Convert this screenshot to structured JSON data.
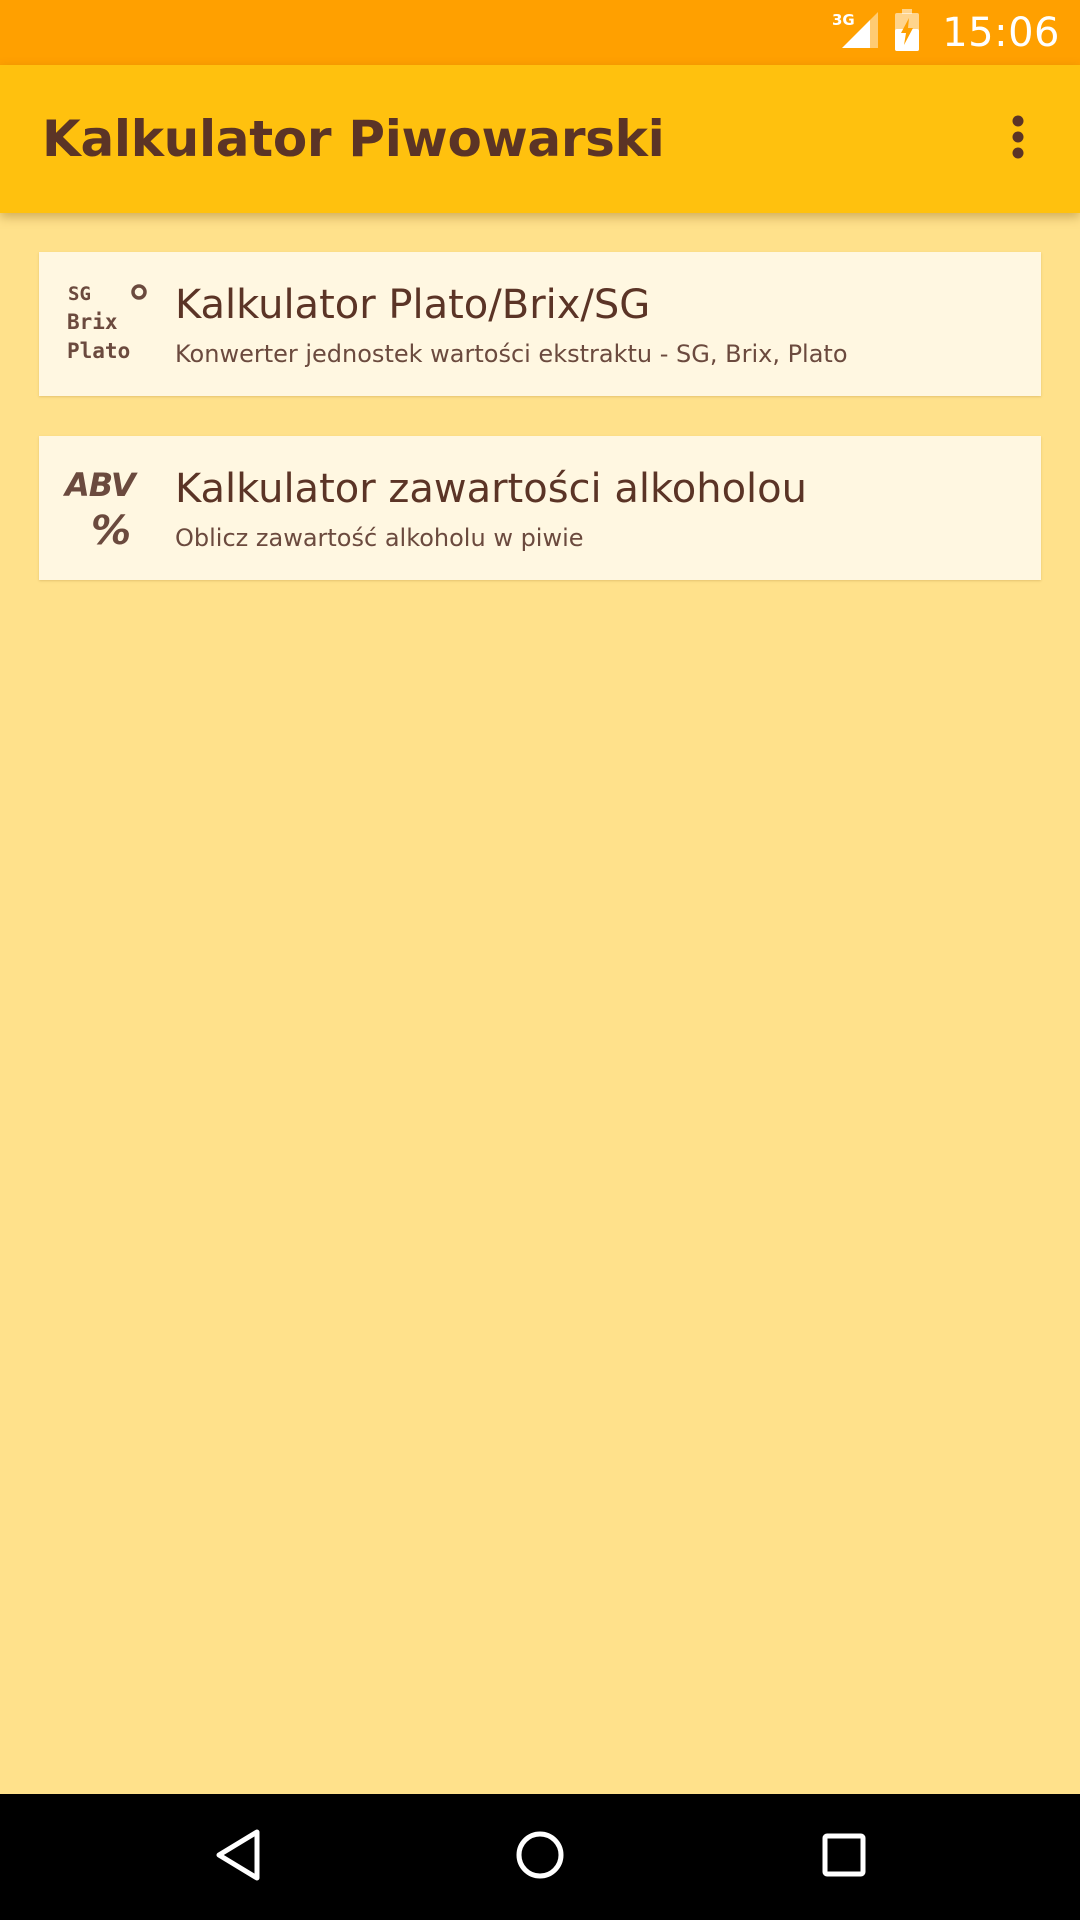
{
  "status_bar": {
    "network": "3G",
    "time": "15:06",
    "icons": [
      "signal-icon",
      "battery-charging-icon"
    ]
  },
  "app_bar": {
    "title": "Kalkulator Piwowarski",
    "overflow_icon": "more-vert-icon"
  },
  "menu": {
    "items": [
      {
        "icon": "plato-brix-sg-icon",
        "icon_text": [
          "SG",
          "Brix",
          "Plato",
          "°"
        ],
        "title": "Kalkulator Plato/Brix/SG",
        "subtitle": "Konwerter jednostek wartości ekstraktu - SG, Brix, Plato"
      },
      {
        "icon": "abv-percent-icon",
        "icon_text": [
          "ABV",
          "%"
        ],
        "title": "Kalkulator zawartości alkoholou",
        "subtitle": "Oblicz zawartość alkoholu w piwie"
      }
    ]
  },
  "nav_bar": {
    "buttons": [
      "back-icon",
      "home-icon",
      "recents-icon"
    ]
  },
  "colors": {
    "status_bar": "#FFA000",
    "app_bar": "#FFC10E",
    "background": "#FFE18B",
    "card": "#FFF7E1",
    "text_primary": "#5B3426",
    "text_secondary": "#6B4A3E"
  }
}
